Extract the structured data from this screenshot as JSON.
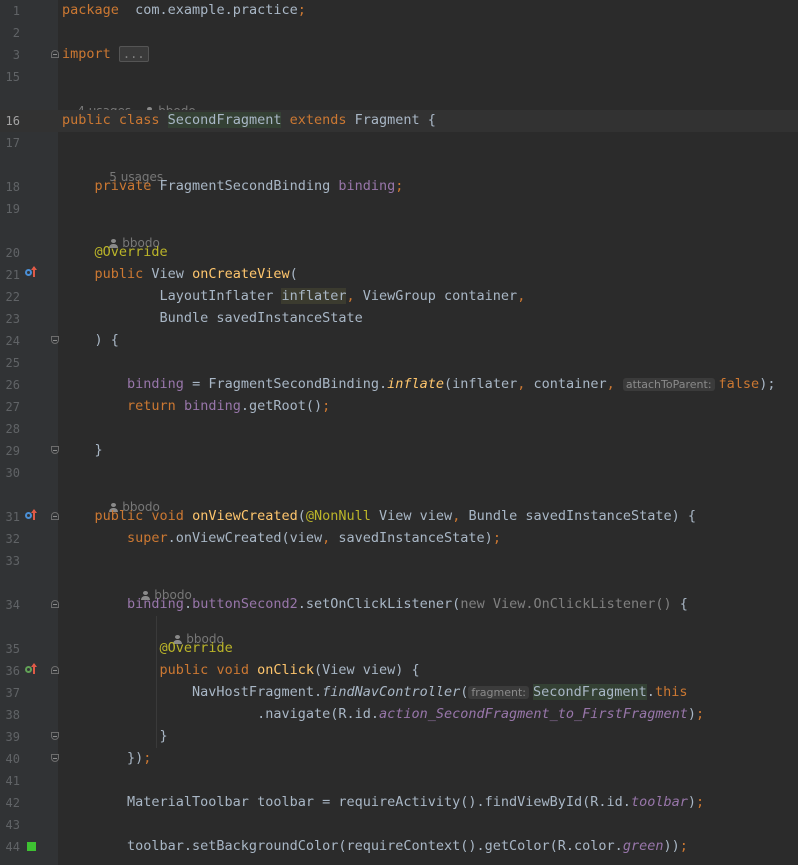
{
  "editor": {
    "lines": [
      {
        "n": "1",
        "segs": [
          [
            "kw",
            "package"
          ],
          [
            "",
            "  com.example.practice"
          ],
          [
            "kw",
            ";"
          ]
        ]
      },
      {
        "n": "2",
        "segs": []
      },
      {
        "n": "3",
        "segs": [
          [
            "kw",
            "import"
          ],
          [
            "",
            " "
          ],
          [
            "fold",
            "..."
          ]
        ]
      },
      {
        "n": "15",
        "segs": []
      },
      {
        "n": "16",
        "current": true,
        "segs": [
          [
            "kw",
            "public class "
          ],
          [
            "hl",
            "SecondFragment"
          ],
          [
            "kw",
            " extends "
          ],
          [
            "",
            "Fragment {"
          ]
        ]
      },
      {
        "n": "17",
        "segs": []
      },
      {
        "n": "18",
        "segs": [
          [
            "",
            "    "
          ],
          [
            "kw",
            "private "
          ],
          [
            "",
            "FragmentSecondBinding "
          ],
          [
            "field",
            "binding"
          ],
          [
            "kw",
            ";"
          ]
        ]
      },
      {
        "n": "19",
        "segs": []
      },
      {
        "n": "20",
        "segs": [
          [
            "",
            "    "
          ],
          [
            "ann",
            "@Override"
          ]
        ]
      },
      {
        "n": "21",
        "segs": [
          [
            "",
            "    "
          ],
          [
            "kw",
            "public "
          ],
          [
            "",
            "View "
          ],
          [
            "fn",
            "onCreateView"
          ],
          [
            "",
            "("
          ]
        ]
      },
      {
        "n": "22",
        "segs": [
          [
            "",
            "            LayoutInflater "
          ],
          [
            "hl2",
            "inflater"
          ],
          [
            "kw",
            ","
          ],
          [
            "",
            " ViewGroup container"
          ],
          [
            "kw",
            ","
          ]
        ]
      },
      {
        "n": "23",
        "segs": [
          [
            "",
            "            Bundle savedInstanceState"
          ]
        ]
      },
      {
        "n": "24",
        "segs": [
          [
            "",
            "    ) {"
          ]
        ]
      },
      {
        "n": "25",
        "segs": []
      },
      {
        "n": "26",
        "segs": [
          [
            "",
            "        "
          ],
          [
            "field",
            "binding"
          ],
          [
            "",
            " = FragmentSecondBinding."
          ],
          [
            "fnit",
            "inflate"
          ],
          [
            "",
            "(inflater"
          ],
          [
            "kw",
            ","
          ],
          [
            "",
            " container"
          ],
          [
            "kw",
            ","
          ],
          [
            "",
            " "
          ],
          [
            "param",
            "attachToParent:"
          ],
          [
            "kw",
            "false"
          ],
          [
            "",
            "); "
          ]
        ]
      },
      {
        "n": "27",
        "segs": [
          [
            "",
            "        "
          ],
          [
            "kw",
            "return "
          ],
          [
            "field",
            "binding"
          ],
          [
            "",
            ".getRoot()"
          ],
          [
            "kw",
            ";"
          ]
        ]
      },
      {
        "n": "28",
        "segs": []
      },
      {
        "n": "29",
        "segs": [
          [
            "",
            "    }"
          ]
        ]
      },
      {
        "n": "30",
        "segs": []
      },
      {
        "n": "31",
        "segs": [
          [
            "",
            "    "
          ],
          [
            "kw",
            "public void "
          ],
          [
            "fn",
            "onViewCreated"
          ],
          [
            "",
            "("
          ],
          [
            "ann",
            "@NonNull"
          ],
          [
            "",
            " View view"
          ],
          [
            "kw",
            ","
          ],
          [
            "",
            " Bundle savedInstanceState) {"
          ]
        ]
      },
      {
        "n": "32",
        "segs": [
          [
            "",
            "        "
          ],
          [
            "kw",
            "super"
          ],
          [
            "",
            ".onViewCreated(view"
          ],
          [
            "kw",
            ","
          ],
          [
            "",
            " savedInstanceState)"
          ],
          [
            "kw",
            ";"
          ]
        ]
      },
      {
        "n": "33",
        "segs": []
      },
      {
        "n": "34",
        "segs": [
          [
            "",
            "        "
          ],
          [
            "field",
            "binding"
          ],
          [
            "",
            "."
          ],
          [
            "field",
            "buttonSecond2"
          ],
          [
            "",
            ".setOnClickListener("
          ],
          [
            "gray",
            "new View.OnClickListener()"
          ],
          [
            "",
            " {"
          ]
        ]
      },
      {
        "n": "35",
        "segs": [
          [
            "",
            "            "
          ],
          [
            "ann",
            "@Override"
          ]
        ]
      },
      {
        "n": "36",
        "segs": [
          [
            "",
            "            "
          ],
          [
            "kw",
            "public void "
          ],
          [
            "fn",
            "onClick"
          ],
          [
            "",
            "(View view) {"
          ]
        ]
      },
      {
        "n": "37",
        "segs": [
          [
            "",
            "                NavHostFragment."
          ],
          [
            "it",
            "findNavController"
          ],
          [
            "",
            "("
          ],
          [
            "param",
            "fragment:"
          ],
          [
            "hl",
            "SecondFragment"
          ],
          [
            "",
            "."
          ],
          [
            "kw",
            "this"
          ],
          [
            ")"
          ]
        ]
      },
      {
        "n": "38",
        "segs": [
          [
            "",
            "                        .navigate(R.id."
          ],
          [
            "fieldit",
            "action_SecondFragment_to_FirstFragment"
          ],
          [
            "",
            ")"
          ],
          [
            "kw",
            ";"
          ]
        ]
      },
      {
        "n": "39",
        "segs": [
          [
            "",
            "            }"
          ]
        ]
      },
      {
        "n": "40",
        "segs": [
          [
            "",
            "        })"
          ],
          [
            "kw",
            ";"
          ]
        ]
      },
      {
        "n": "41",
        "segs": []
      },
      {
        "n": "42",
        "segs": [
          [
            "",
            "        MaterialToolbar toolbar = requireActivity().findViewById(R.id."
          ],
          [
            "fieldit",
            "toolbar"
          ],
          [
            "",
            ")"
          ],
          [
            "kw",
            ";"
          ]
        ]
      },
      {
        "n": "43",
        "segs": []
      },
      {
        "n": "44",
        "segs": [
          [
            "",
            "        toolbar.setBackgroundColor(requireContext().getColor(R.color."
          ],
          [
            "fieldit",
            "green"
          ],
          [
            "",
            "))"
          ],
          [
            "kw",
            ";"
          ]
        ]
      }
    ],
    "hints": {
      "class_usages": "4 usages",
      "class_author": "bbodo",
      "binding_usages": "5 usages",
      "oncreate_author": "bbodo",
      "onview_author": "bbodo",
      "listener_author": "bbodo",
      "onclick_author": "bbodo"
    }
  }
}
